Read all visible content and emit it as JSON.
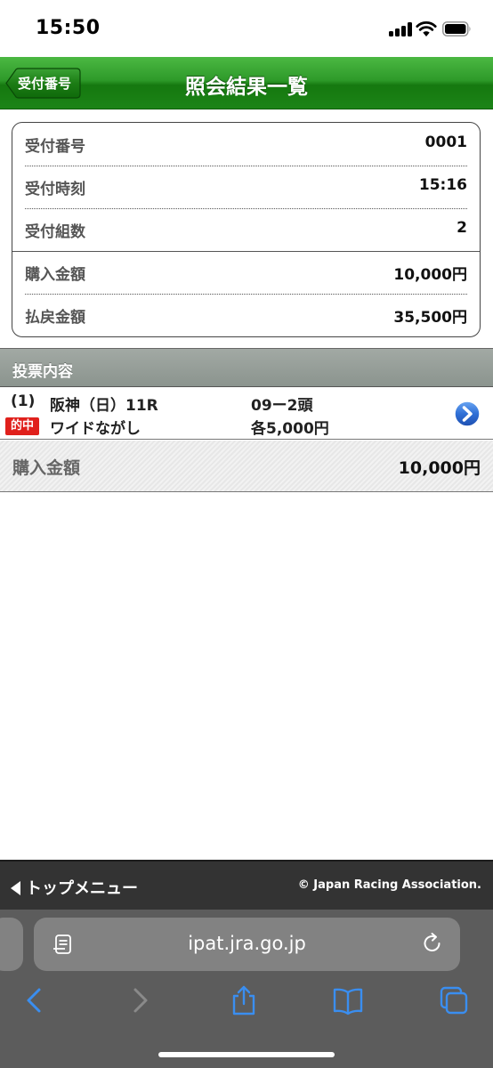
{
  "status_bar": {
    "time": "15:50"
  },
  "header": {
    "back_label": "受付番号",
    "title": "照会結果一覧"
  },
  "summary": [
    {
      "label": "受付番号",
      "value": "0001"
    },
    {
      "label": "受付時刻",
      "value": "15:16"
    },
    {
      "label": "受付組数",
      "value": "2"
    },
    {
      "label": "購入金額",
      "value": "10,000円"
    },
    {
      "label": "払戻金額",
      "value": "35,500円"
    }
  ],
  "section": {
    "title": "投票内容"
  },
  "bet": {
    "index": "(1)",
    "race": "阪神（日）11R",
    "combo": "09ー2頭",
    "hit_badge": "的中",
    "type": "ワイドながし",
    "amount": "各5,000円"
  },
  "total": {
    "label": "購入金額",
    "value": "10,000円"
  },
  "footer": {
    "menu_label": "トップメニュー",
    "copyright": "© Japan Racing Association."
  },
  "browser": {
    "url": "ipat.jra.go.jp"
  },
  "colors": {
    "header_green": "#2e9a2a",
    "hit_red": "#e0201c",
    "arrow_blue": "#2f6fd6",
    "safari_blue": "#3a8ef0"
  }
}
